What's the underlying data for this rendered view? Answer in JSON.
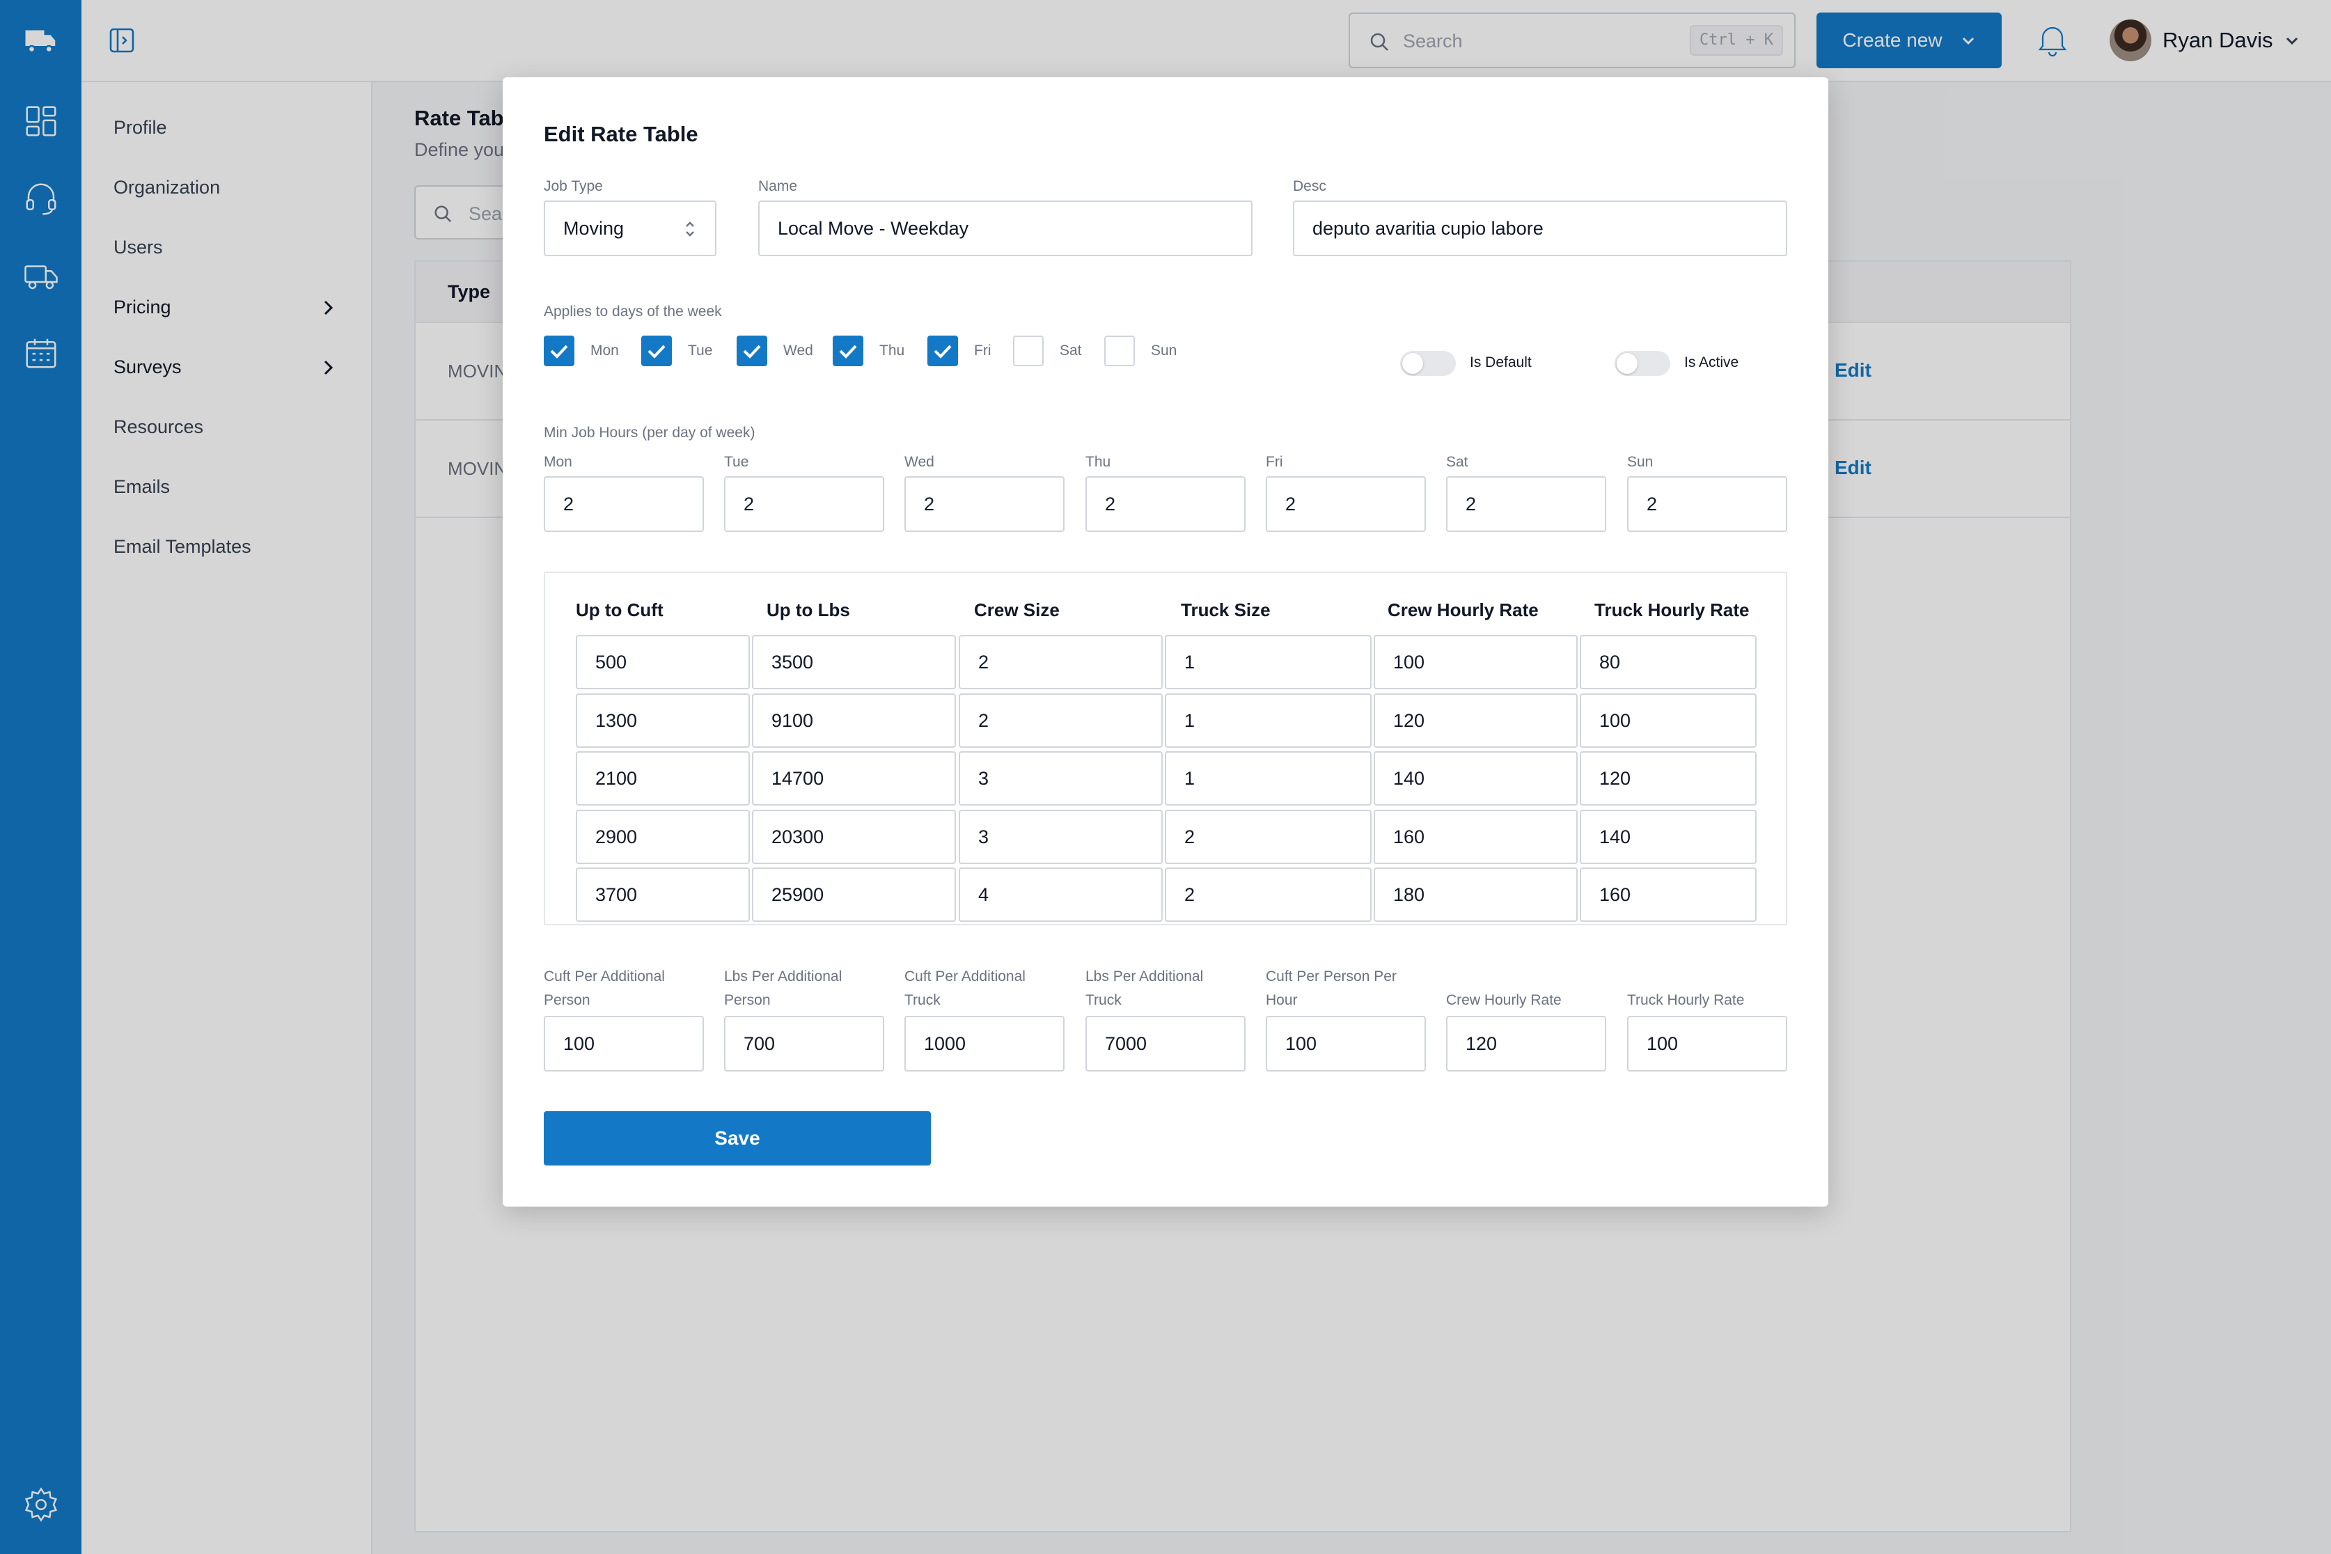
{
  "topbar": {
    "search_placeholder": "Search",
    "search_shortcut": "Ctrl + K",
    "create_new_label": "Create new",
    "user_name": "Ryan Davis"
  },
  "subnav": {
    "items": [
      {
        "label": "Profile"
      },
      {
        "label": "Organization"
      },
      {
        "label": "Users"
      },
      {
        "label": "Pricing",
        "has_children": true
      },
      {
        "label": "Surveys",
        "has_children": true
      },
      {
        "label": "Resources"
      },
      {
        "label": "Emails"
      },
      {
        "label": "Email Templates"
      }
    ]
  },
  "page": {
    "title": "Rate Tabl",
    "subtitle": "Define you",
    "search_placeholder": "Sear",
    "table_header_type": "Type",
    "rows": [
      {
        "type": "MOVIN",
        "action": "Edit"
      },
      {
        "type": "MOVIN",
        "action": "Edit"
      }
    ]
  },
  "modal": {
    "title": "Edit Rate Table",
    "job_type": {
      "label": "Job Type",
      "value": "Moving"
    },
    "name": {
      "label": "Name",
      "value": "Local Move - Weekday"
    },
    "desc": {
      "label": "Desc",
      "value": "deputo avaritia cupio labore"
    },
    "days_label": "Applies to days of the week",
    "days": [
      {
        "label": "Mon",
        "checked": true
      },
      {
        "label": "Tue",
        "checked": true
      },
      {
        "label": "Wed",
        "checked": true
      },
      {
        "label": "Thu",
        "checked": true
      },
      {
        "label": "Fri",
        "checked": true
      },
      {
        "label": "Sat",
        "checked": false
      },
      {
        "label": "Sun",
        "checked": false
      }
    ],
    "is_default": {
      "label": "Is Default",
      "on": false
    },
    "is_active": {
      "label": "Is Active",
      "on": false
    },
    "min_hours_label": "Min Job Hours (per day of week)",
    "min_hours": [
      {
        "label": "Mon",
        "value": "2"
      },
      {
        "label": "Tue",
        "value": "2"
      },
      {
        "label": "Wed",
        "value": "2"
      },
      {
        "label": "Thu",
        "value": "2"
      },
      {
        "label": "Fri",
        "value": "2"
      },
      {
        "label": "Sat",
        "value": "2"
      },
      {
        "label": "Sun",
        "value": "2"
      }
    ],
    "rate_columns": [
      "Up to Cuft",
      "Up to Lbs",
      "Crew Size",
      "Truck Size",
      "Crew Hourly Rate",
      "Truck Hourly Rate"
    ],
    "rate_rows": [
      [
        "500",
        "3500",
        "2",
        "1",
        "100",
        "80"
      ],
      [
        "1300",
        "9100",
        "2",
        "1",
        "120",
        "100"
      ],
      [
        "2100",
        "14700",
        "3",
        "1",
        "140",
        "120"
      ],
      [
        "2900",
        "20300",
        "3",
        "2",
        "160",
        "140"
      ],
      [
        "3700",
        "25900",
        "4",
        "2",
        "180",
        "160"
      ]
    ],
    "extras": [
      {
        "label_1": "Cuft Per Additional",
        "label_2": "Person",
        "value": "100"
      },
      {
        "label_1": "Lbs Per Additional",
        "label_2": "Person",
        "value": "700"
      },
      {
        "label_1": "Cuft Per Additional",
        "label_2": "Truck",
        "value": "1000"
      },
      {
        "label_1": "Lbs Per Additional",
        "label_2": "Truck",
        "value": "7000"
      },
      {
        "label_1": "Cuft Per Person Per",
        "label_2": "Hour",
        "value": "100"
      },
      {
        "label_1": "",
        "label_2": "Crew Hourly Rate",
        "value": "120"
      },
      {
        "label_1": "",
        "label_2": "Truck Hourly Rate",
        "value": "100"
      }
    ],
    "save_label": "Save"
  },
  "colors": {
    "primary": "#1379c6",
    "overlay": "rgba(0,0,0,0.16)"
  }
}
